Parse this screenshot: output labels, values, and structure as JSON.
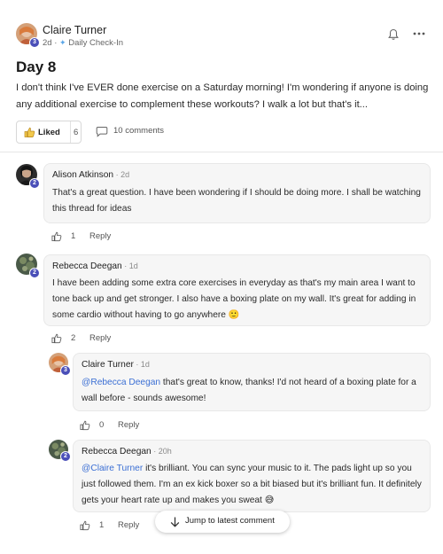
{
  "post": {
    "author": "Claire Turner",
    "time": "2d",
    "meta_sep": " · ",
    "sparkle_icon": "✦",
    "channel": "Daily Check-In",
    "level": "3",
    "title": "Day 8",
    "body": "I don't think I've EVER done exercise on a Saturday morning! I'm wondering if anyone is doing any additional exercise to complement these workouts? I walk a lot but that's it...",
    "liked_label": "Liked",
    "like_count": "6",
    "comments_label": "10 comments"
  },
  "comments": [
    {
      "author": "Alison Atkinson",
      "time": " · 2d",
      "level": "2",
      "text": "That's a great question. I have been wondering if I should be doing more. I shall be watching this thread for ideas",
      "likes": "1",
      "reply_label": "Reply"
    },
    {
      "author": "Rebecca Deegan",
      "time": " · 1d",
      "level": "2",
      "text": "I have been adding some extra core exercises in everyday as that's my main area I want to tone back up and get stronger. I also have a boxing plate on my wall. It's great for adding in some cardio without having to go anywhere 🙂",
      "likes": "2",
      "reply_label": "Reply"
    },
    {
      "author": "Claire Turner",
      "time": " · 1d",
      "level": "3",
      "mention": "@Rebecca Deegan",
      "text": " that's great to know, thanks! I'd not heard of a boxing plate for a wall before - sounds awesome!",
      "likes": "0",
      "reply_label": "Reply"
    },
    {
      "author": "Rebecca Deegan",
      "time": " · 20h",
      "level": "2",
      "mention": "@Claire Turner",
      "text": " it's brilliant. You can sync your music to it. The pads light up so you just followed them. I'm an ex kick boxer so a bit biased but it's brilliant fun. It definitely gets your heart rate up and makes you sweat 😅",
      "likes": "1",
      "reply_label": "Reply"
    }
  ],
  "jump_button": {
    "label": "Jump to latest comment"
  },
  "colors": {
    "accent": "#3b6fd4",
    "badge": "#4a4fb8",
    "comment_bg": "#f6f6f6"
  },
  "icons": [
    "bell-icon",
    "more-icon",
    "thumbs-up-icon",
    "comment-bubble-icon",
    "arrow-down-icon",
    "sparkle-icon"
  ]
}
